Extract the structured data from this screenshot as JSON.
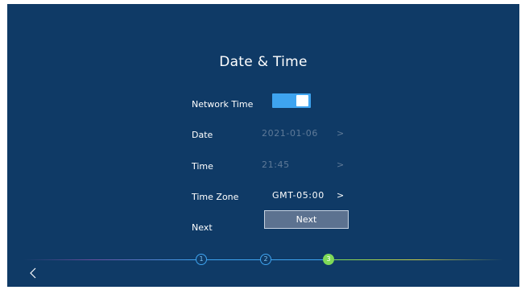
{
  "page": {
    "title": "Date & Time"
  },
  "network_time": {
    "label": "Network Time",
    "enabled": true
  },
  "date": {
    "label": "Date",
    "value": "2021-01-06",
    "chevron": ">"
  },
  "time": {
    "label": "Time",
    "value": "21:45",
    "chevron": ">"
  },
  "time_zone": {
    "label": "Time Zone",
    "value": "GMT-05:00",
    "chevron": ">"
  },
  "next_row": {
    "label": "Next",
    "button_label": "Next"
  },
  "steps": {
    "items": [
      "1",
      "2",
      "3"
    ],
    "current": 3
  },
  "nav": {
    "back_icon": "chevron-left-icon"
  },
  "colors": {
    "background": "#0f3a66",
    "accent": "#3ea4f0",
    "step_done": "#7ed957"
  }
}
